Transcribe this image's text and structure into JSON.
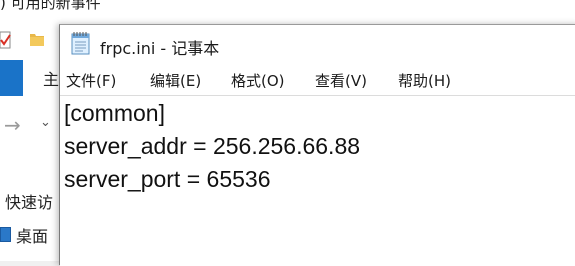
{
  "background_window": {
    "title_partial": ") 可用的新事件",
    "ribbon_home_tab": "主",
    "nav": {
      "quick_access": "快速访",
      "desktop": "桌面"
    },
    "icons": {
      "check": "checkmark-icon",
      "folder": "folder-icon",
      "forward": "forward-arrow-icon",
      "dropdown": "chevron-down-icon",
      "desktop": "desktop-folder-icon"
    },
    "colors": {
      "file_tab": "#1a73c8"
    }
  },
  "notepad": {
    "title": "frpc.ini - 记事本",
    "icon": "notepad-icon",
    "menu": [
      {
        "label": "文件(F)"
      },
      {
        "label": "编辑(E)"
      },
      {
        "label": "格式(O)"
      },
      {
        "label": "查看(V)"
      },
      {
        "label": "帮助(H)"
      }
    ],
    "content_lines": [
      "[common]",
      "server_addr = 256.256.66.88",
      "server_port = 65536"
    ]
  }
}
